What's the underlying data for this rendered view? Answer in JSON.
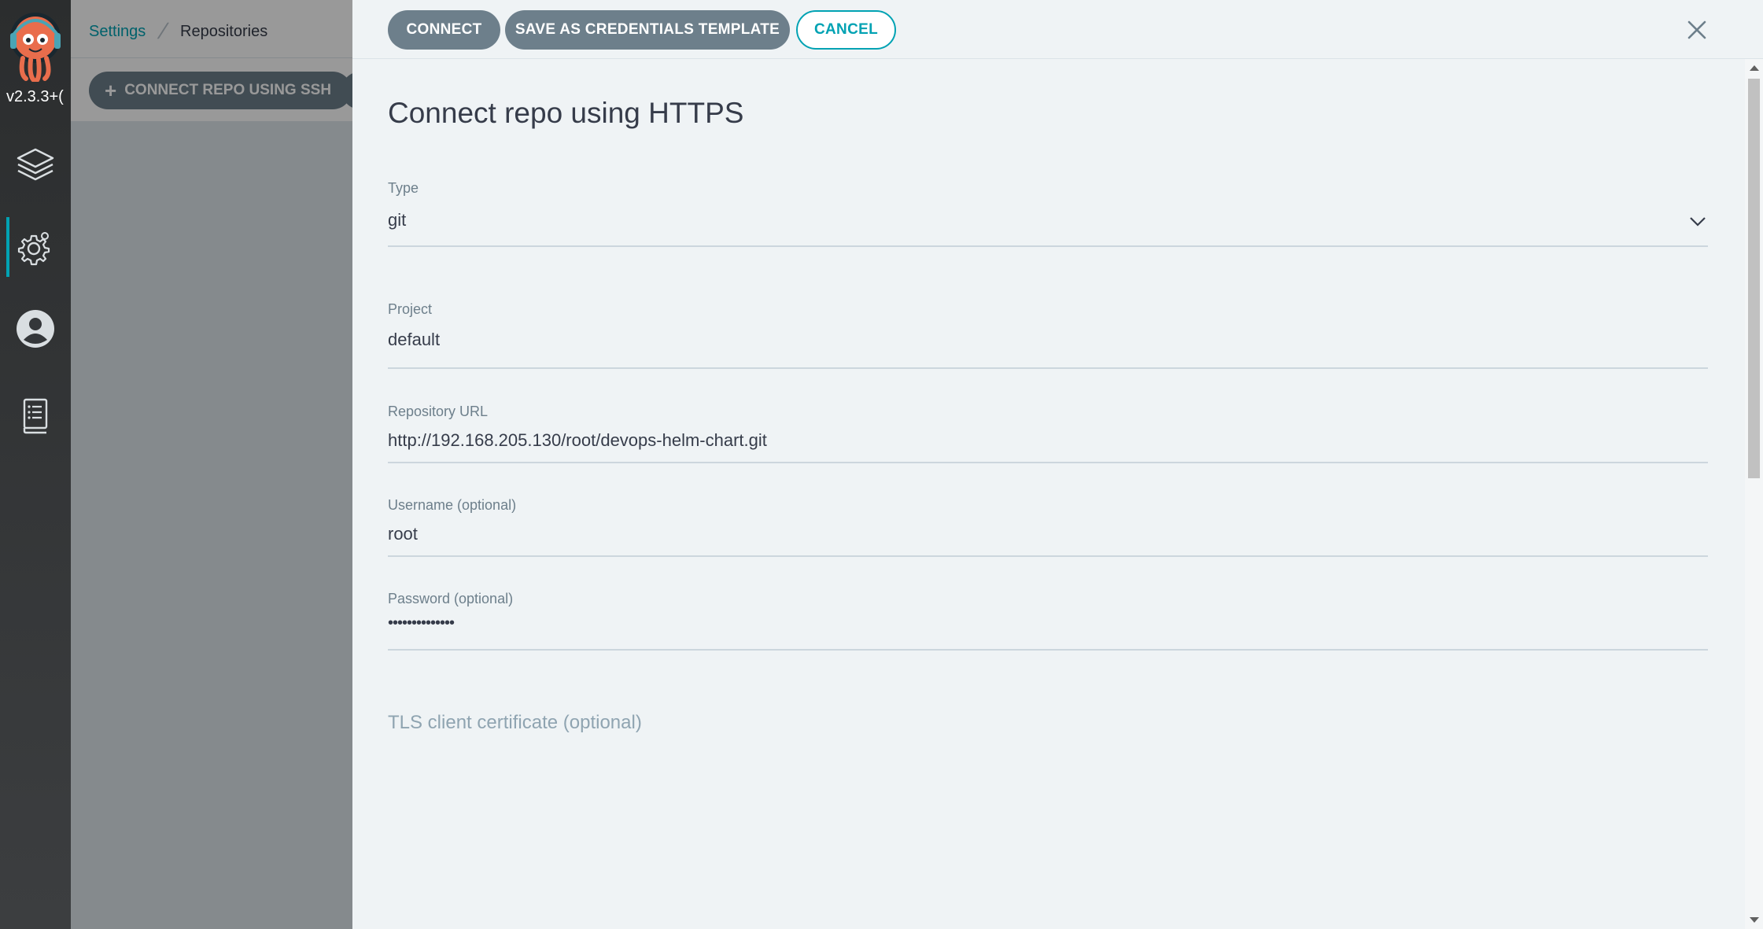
{
  "app": {
    "version": "v2.3.3+("
  },
  "nav": {
    "items": [
      {
        "icon": "layers-icon",
        "active": false
      },
      {
        "icon": "gear-icon",
        "active": true
      },
      {
        "icon": "user-icon",
        "active": false
      },
      {
        "icon": "docs-icon",
        "active": false
      }
    ]
  },
  "breadcrumb": {
    "parent": "Settings",
    "current": "Repositories"
  },
  "toolbar": {
    "connect_ssh_label": "CONNECT REPO USING SSH"
  },
  "panel": {
    "connect_label": "CONNECT",
    "save_template_label": "SAVE AS CREDENTIALS TEMPLATE",
    "cancel_label": "CANCEL",
    "title": "Connect repo using HTTPS",
    "fields": {
      "type": {
        "label": "Type",
        "value": "git"
      },
      "project": {
        "label": "Project",
        "value": "default"
      },
      "repo_url": {
        "label": "Repository URL",
        "value": "http://192.168.205.130/root/devops-helm-chart.git"
      },
      "username": {
        "label": "Username (optional)",
        "value": "root"
      },
      "password": {
        "label": "Password (optional)",
        "value": "••••••••••••••"
      }
    },
    "tls_section": "TLS client certificate (optional)"
  },
  "colors": {
    "accent": "#00a2b3",
    "button": "#6d7f8b",
    "panel_bg": "#eff3f5",
    "nav_bg": "#2b2d2e"
  }
}
